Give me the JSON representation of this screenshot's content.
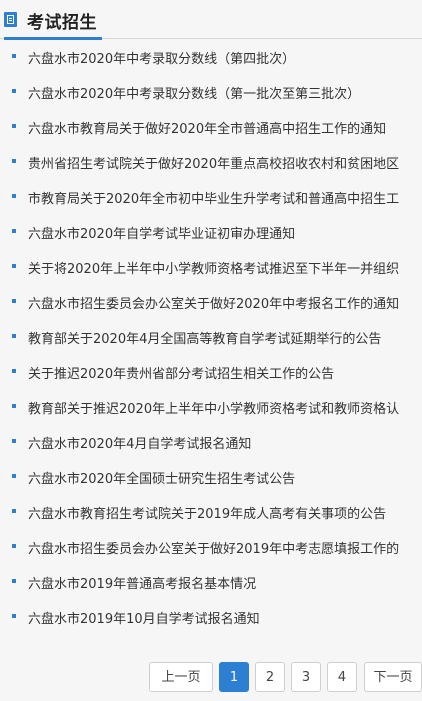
{
  "header": {
    "title": "考试招生",
    "icon": "document-icon",
    "accent": "#2d7fd2"
  },
  "items": [
    "六盘水市2020年中考录取分数线（第四批次）",
    "六盘水市2020年中考录取分数线（第一批次至第三批次）",
    "六盘水市教育局关于做好2020年全市普通高中招生工作的通知",
    "贵州省招生考试院关于做好2020年重点高校招收农村和贫困地区",
    "市教育局关于2020年全市初中毕业生升学考试和普通高中招生工",
    "六盘水市2020年自学考试毕业证初审办理通知",
    "关于将2020年上半年中小学教师资格考试推迟至下半年一并组织",
    "六盘水市招生委员会办公室关于做好2020年中考报名工作的通知",
    "教育部关于2020年4月全国高等教育自学考试延期举行的公告",
    "关于推迟2020年贵州省部分考试招生相关工作的公告",
    "教育部关于推迟2020年上半年中小学教师资格考试和教师资格认",
    "六盘水市2020年4月自学考试报名通知",
    "六盘水市2020年全国硕士研究生招生考试公告",
    "六盘水市教育招生考试院关于2019年成人高考有关事项的公告",
    "六盘水市招生委员会办公室关于做好2019年中考志愿填报工作的",
    "六盘水市2019年普通高考报名基本情况",
    "六盘水市2019年10月自学考试报名通知"
  ],
  "pager": {
    "prev": "上一页",
    "pages": [
      "1",
      "2",
      "3",
      "4"
    ],
    "current": "1",
    "next": "下一页"
  }
}
